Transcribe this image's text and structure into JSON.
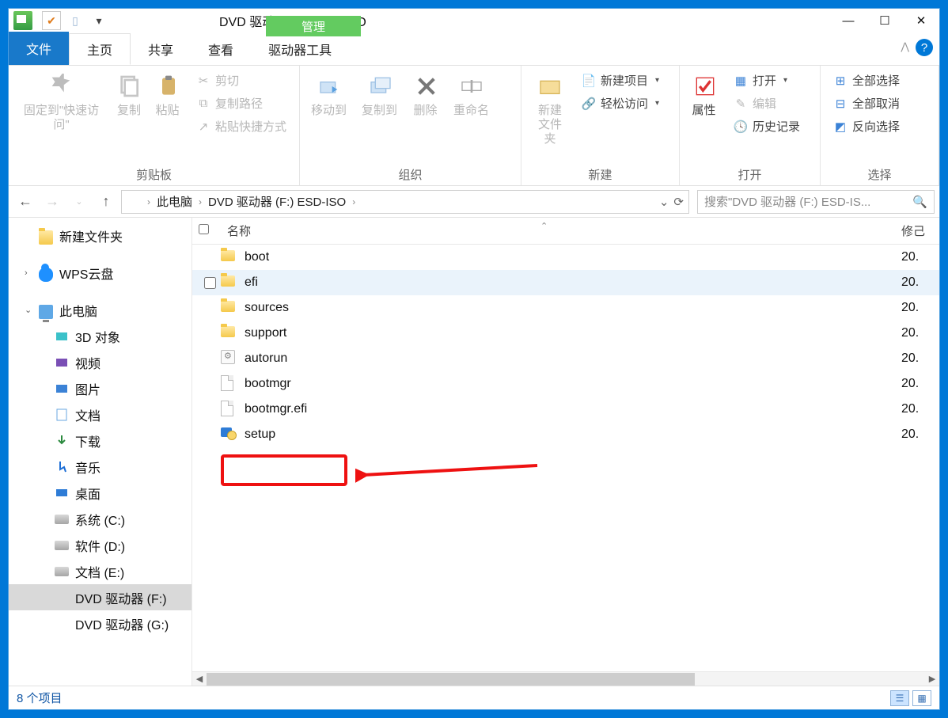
{
  "window_title": "DVD 驱动器 (F:) ESD-ISO",
  "context_tab_header": "管理",
  "tabs": {
    "file": "文件",
    "home": "主页",
    "share": "共享",
    "view": "查看",
    "drive_tools": "驱动器工具"
  },
  "ribbon": {
    "clipboard": {
      "label": "剪贴板",
      "pin": "固定到\"快速访问\"",
      "copy": "复制",
      "paste": "粘贴",
      "cut": "剪切",
      "copy_path": "复制路径",
      "paste_shortcut": "粘贴快捷方式"
    },
    "organize": {
      "label": "组织",
      "move_to": "移动到",
      "copy_to": "复制到",
      "delete": "删除",
      "rename": "重命名"
    },
    "new": {
      "label": "新建",
      "new_folder": "新建文件夹",
      "new_item": "新建项目",
      "easy_access": "轻松访问"
    },
    "open": {
      "label": "打开",
      "properties": "属性",
      "open": "打开",
      "edit": "编辑",
      "history": "历史记录"
    },
    "select": {
      "label": "选择",
      "select_all": "全部选择",
      "select_none": "全部取消",
      "invert": "反向选择"
    }
  },
  "breadcrumb": {
    "this_pc": "此电脑",
    "drive": "DVD 驱动器 (F:) ESD-ISO"
  },
  "search_placeholder": "搜索\"DVD 驱动器 (F:) ESD-IS...",
  "columns": {
    "name": "名称",
    "modified": "修己"
  },
  "nav": {
    "new_folder": "新建文件夹",
    "wps": "WPS云盘",
    "this_pc": "此电脑",
    "items": [
      "3D 对象",
      "视频",
      "图片",
      "文档",
      "下载",
      "音乐",
      "桌面",
      "系统 (C:)",
      "软件 (D:)",
      "文档 (E:)",
      "DVD 驱动器 (F:)",
      "DVD 驱动器 (G:)"
    ]
  },
  "files": [
    {
      "name": "boot",
      "type": "folder",
      "mod": "20."
    },
    {
      "name": "efi",
      "type": "folder",
      "mod": "20.",
      "hover": true
    },
    {
      "name": "sources",
      "type": "folder",
      "mod": "20."
    },
    {
      "name": "support",
      "type": "folder",
      "mod": "20."
    },
    {
      "name": "autorun",
      "type": "inf",
      "mod": "20."
    },
    {
      "name": "bootmgr",
      "type": "file",
      "mod": "20."
    },
    {
      "name": "bootmgr.efi",
      "type": "file",
      "mod": "20."
    },
    {
      "name": "setup",
      "type": "setup",
      "mod": "20."
    }
  ],
  "status": "8 个项目"
}
